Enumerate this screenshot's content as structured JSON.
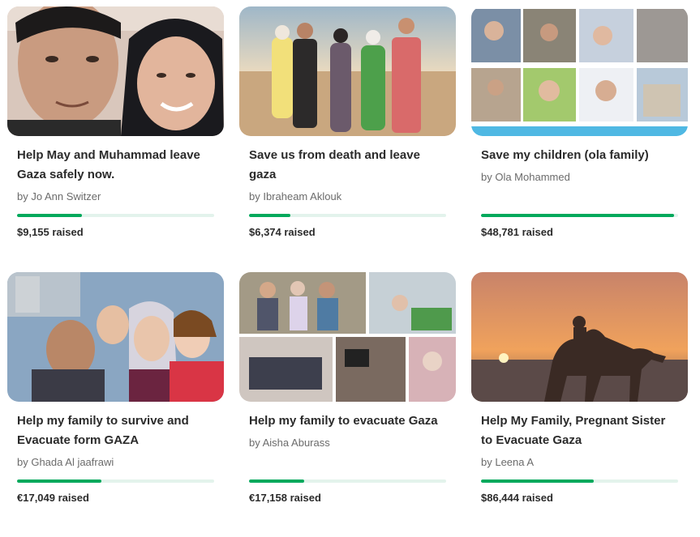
{
  "campaigns": [
    {
      "title_line1": "Help May and Muhammad leave",
      "title_line2": "Gaza safely now.",
      "byline": "by Jo Ann Switzer",
      "raised": "$9,155 raised",
      "progress": 0.33
    },
    {
      "title_line1": "Save us from death and leave",
      "title_line2": "gaza",
      "byline": "by Ibraheam Aklouk",
      "raised": "$6,374 raised",
      "progress": 0.21
    },
    {
      "title_line1": "Save my children (ola family)",
      "title_line2": "",
      "byline": "by Ola Mohammed",
      "raised": "$48,781 raised",
      "progress": 0.98
    },
    {
      "title_line1": "Help my family to survive and",
      "title_line2": "Evacuate form GAZA",
      "byline": "by Ghada Al jaafrawi",
      "raised": "€17,049 raised",
      "progress": 0.43
    },
    {
      "title_line1": "Help my family to evacuate Gaza",
      "title_line2": "",
      "byline": "by Aisha Aburass",
      "raised": "€17,158 raised",
      "progress": 0.28
    },
    {
      "title_line1": "Help My Family, Pregnant Sister",
      "title_line2": "to Evacuate Gaza",
      "byline": "by Leena A",
      "raised": "$86,444 raised",
      "progress": 0.57
    }
  ],
  "colors": {
    "progress_fill": "#02a95c",
    "progress_track": "#e3f3ec",
    "title_text": "#2b2b2b",
    "byline_text": "#6b6b6b"
  }
}
